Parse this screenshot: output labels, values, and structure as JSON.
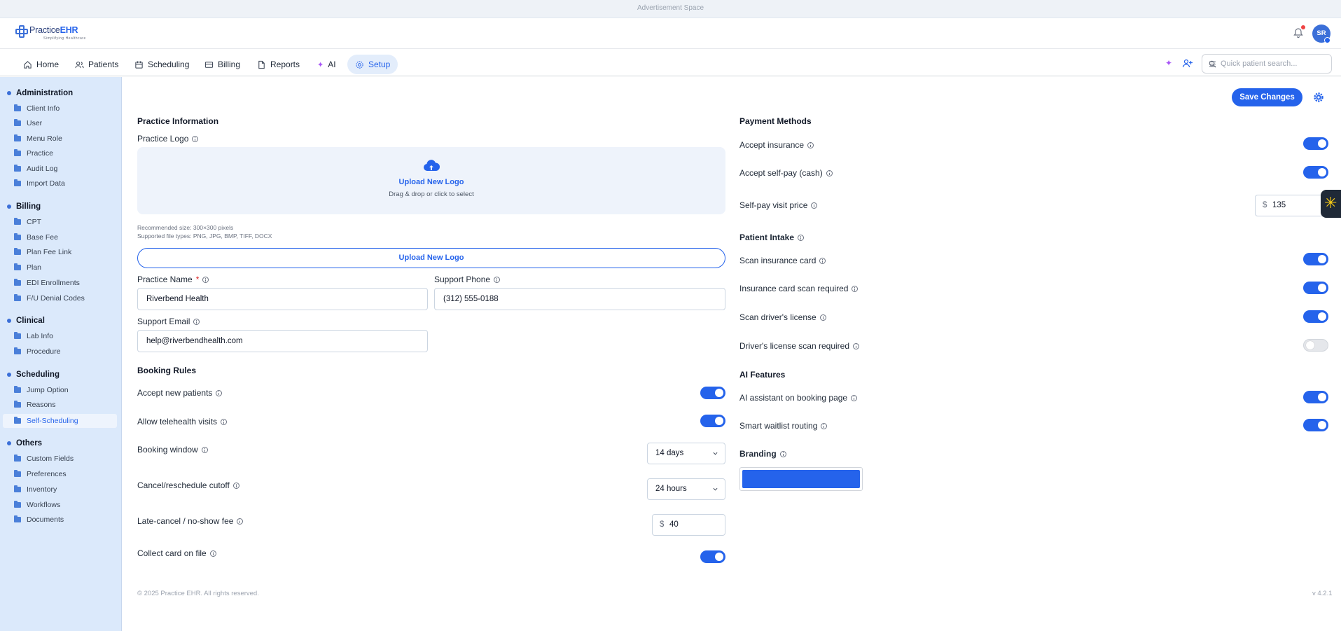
{
  "ad_bar": {
    "text": "Advertisement Space"
  },
  "app": {
    "logo_text_a": "Practice",
    "logo_text_b": "EHR",
    "logo_tagline": "Simplifying Healthcare",
    "avatar_initials": "SR"
  },
  "nav": {
    "items": [
      {
        "label": "Home",
        "icon": "home-icon"
      },
      {
        "label": "Patients",
        "icon": "users-icon"
      },
      {
        "label": "Scheduling",
        "icon": "calendar-icon"
      },
      {
        "label": "Billing",
        "icon": "credit-card-icon"
      },
      {
        "label": "Reports",
        "icon": "file-icon"
      },
      {
        "label": "AI",
        "icon": "sparkle-icon"
      },
      {
        "label": "Setup",
        "icon": "gear-icon",
        "active": true
      }
    ],
    "search_placeholder": "Quick patient search..."
  },
  "sidebar": {
    "sections": [
      {
        "title": "Administration",
        "items": [
          "Client Info",
          "User",
          "Menu Role",
          "Practice",
          "Audit Log",
          "Import Data"
        ]
      },
      {
        "title": "Billing",
        "items": [
          "CPT",
          "Base Fee",
          "Plan Fee Link",
          "Plan",
          "EDI Enrollments",
          "F/U Denial Codes"
        ]
      },
      {
        "title": "Clinical",
        "items": [
          "Lab Info",
          "Procedure"
        ]
      },
      {
        "title": "Scheduling",
        "items": [
          "Jump Option",
          "Reasons",
          "Self-Scheduling"
        ]
      },
      {
        "title": "Others",
        "items": [
          "Custom Fields",
          "Preferences",
          "Inventory",
          "Workflows",
          "Documents"
        ]
      }
    ],
    "active_item": "Self-Scheduling"
  },
  "toolbar": {
    "save_label": "Save Changes"
  },
  "practice_info": {
    "heading": "Practice Information",
    "logo_label": "Practice Logo",
    "dropzone_title": "Upload New Logo",
    "dropzone_sub": "Drag & drop or click to select",
    "hint_size": "Recommended size: 300×300 pixels",
    "hint_types": "Supported file types: PNG, JPG, BMP, TIFF, DOCX",
    "upload_button": "Upload New Logo",
    "name_label": "Practice Name",
    "name_required": "*",
    "name_value": "Riverbend Health",
    "phone_label": "Support Phone",
    "phone_value": "(312) 555-0188",
    "email_label": "Support Email",
    "email_value": "help@riverbendhealth.com"
  },
  "booking_rules": {
    "heading": "Booking Rules",
    "accept_new_patients": {
      "label": "Accept new patients",
      "on": true
    },
    "allow_telehealth": {
      "label": "Allow telehealth visits",
      "on": true
    },
    "booking_window": {
      "label": "Booking window",
      "value": "14 days"
    },
    "cancel_cutoff": {
      "label": "Cancel/reschedule cutoff",
      "value": "24 hours"
    },
    "late_fee": {
      "label": "Late-cancel / no-show fee",
      "currency": "$",
      "value": "40"
    },
    "collect_card": {
      "label": "Collect card on file",
      "on": true
    }
  },
  "payment_methods": {
    "heading": "Payment Methods",
    "accept_insurance": {
      "label": "Accept insurance",
      "on": true
    },
    "accept_self_pay": {
      "label": "Accept self-pay (cash)",
      "on": true
    },
    "self_pay_price": {
      "label": "Self-pay visit price",
      "currency": "$",
      "value": "135"
    }
  },
  "patient_intake": {
    "heading": "Patient Intake",
    "scan_insurance": {
      "label": "Scan insurance card",
      "on": true
    },
    "insurance_required": {
      "label": "Insurance card scan required",
      "on": true
    },
    "scan_license": {
      "label": "Scan driver's license",
      "on": true
    },
    "license_required": {
      "label": "Driver's license scan required",
      "on": false
    }
  },
  "ai_features": {
    "heading": "AI Features",
    "ai_assistant": {
      "label": "AI assistant on booking page",
      "on": true
    },
    "smart_waitlist": {
      "label": "Smart waitlist routing",
      "on": true
    }
  },
  "branding": {
    "heading": "Branding",
    "color": "#2563eb"
  },
  "footer": {
    "copyright": "© 2025 Practice EHR. All rights reserved.",
    "version": "v 4.2.1"
  },
  "colors": {
    "accent": "#2563eb",
    "sidebar_bg": "#dbe9fb"
  }
}
